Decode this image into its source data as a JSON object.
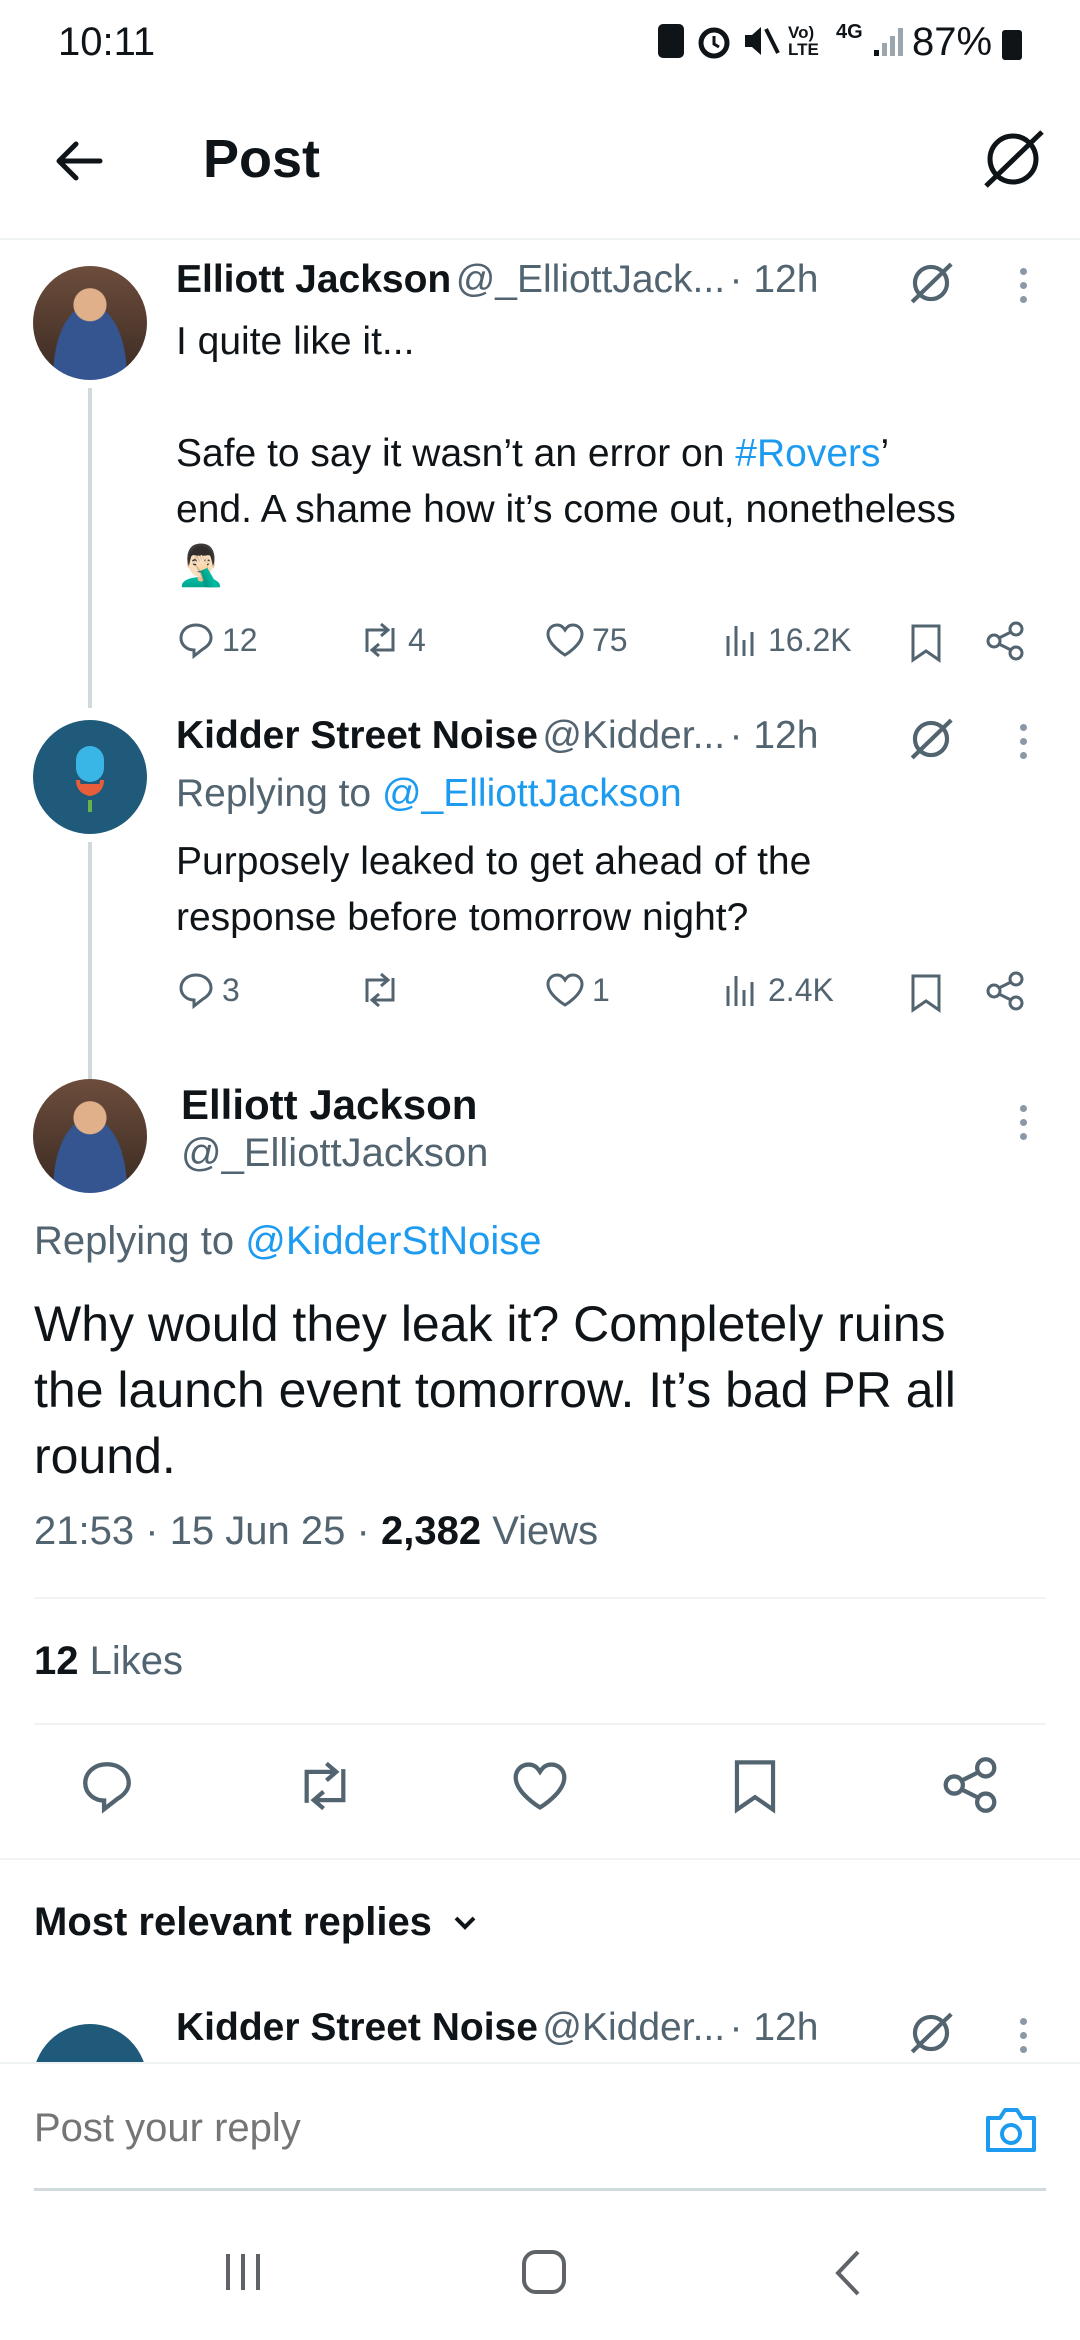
{
  "status_bar": {
    "time": "10:11",
    "net_top": "Vo)",
    "net_bottom": "LTE",
    "net_type": "4G",
    "battery": "87%"
  },
  "header": {
    "title": "Post"
  },
  "tweets": [
    {
      "name": "Elliott Jackson",
      "handle": "@_ElliottJack...",
      "time": "· 12h",
      "text_line1": "I quite like it...",
      "text_line2_pre": "Safe to say it wasn’t an error on ",
      "text_line2_tag": "#Rovers",
      "text_line2_post": "’",
      "text_line3": "end. A shame how it’s come out, nonetheless",
      "emoji": "🤦🏻‍♂️",
      "replies": "12",
      "reposts": "4",
      "likes": "75",
      "views": "16.2K"
    },
    {
      "name": "Kidder Street Noise",
      "handle": "@Kidder...",
      "time": "· 12h",
      "replying_prefix": "Replying to ",
      "replying_handle": "@_ElliottJackson",
      "text_line1": "Purposely leaked to get ahead of the",
      "text_line2": "response before tomorrow night?",
      "replies": "3",
      "reposts": "",
      "likes": "1",
      "views": "2.4K"
    }
  ],
  "main_post": {
    "name": "Elliott Jackson",
    "handle": "@_ElliottJackson",
    "replying_prefix": "Replying to ",
    "replying_handle": "@KidderStNoise",
    "text_line1": "Why would they leak it? Completely ruins",
    "text_line2": "the launch event tomorrow. It’s bad PR all",
    "text_line3": "round.",
    "time": "21:53",
    "sep": "·",
    "date": "15 Jun 25",
    "views_count": "2,382",
    "views_label": "Views",
    "likes_count": "12",
    "likes_label": "Likes"
  },
  "replies_section": {
    "label": "Most relevant replies"
  },
  "preview_reply": {
    "name": "Kidder Street Noise",
    "handle": "@Kidder...",
    "time": "· 12h"
  },
  "composer": {
    "placeholder": "Post your reply"
  },
  "colors": {
    "accent": "#1d9bf0",
    "text": "#0f1419",
    "muted": "#536471",
    "divider": "#eff3f4"
  },
  "icons": [
    "back-arrow-icon",
    "grok-icon",
    "reply-icon",
    "repost-icon",
    "like-icon",
    "views-icon",
    "bookmark-icon",
    "share-icon",
    "camera-icon",
    "more-icon",
    "chevron-down-icon"
  ]
}
